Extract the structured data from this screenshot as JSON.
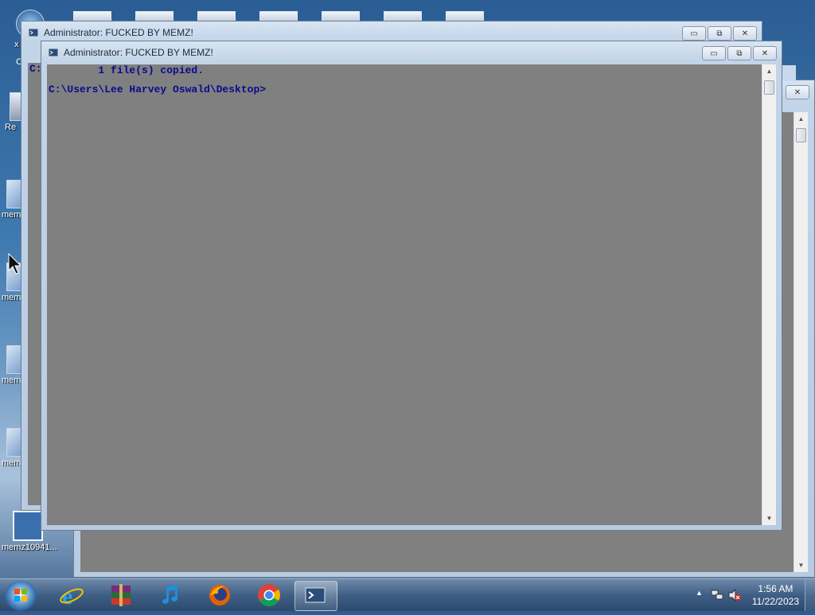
{
  "desktop": {
    "icon_labels": [
      "mem",
      "mem",
      "mem",
      "mem",
      "memz10941..."
    ],
    "partial_labels": [
      "x",
      "C",
      "Re"
    ]
  },
  "windows": {
    "back_title": "Administrator:  FUCKED BY MEMZ!",
    "back_partial_line": "C:",
    "front_title": "Administrator:  FUCKED BY MEMZ!",
    "console_lines": [
      "        1 file(s) copied.",
      "C:\\Users\\Lee Harvey Oswald\\Desktop>"
    ],
    "minimize_glyph": "▭",
    "restore_glyph": "⧉",
    "close_glyph": "✕",
    "scroll_up_glyph": "▲",
    "scroll_down_glyph": "▼"
  },
  "taskbar": {
    "pinned": [
      "internet-explorer-icon",
      "winrar-icon",
      "itunes-icon",
      "firefox-icon",
      "chrome-icon",
      "cmd-icon"
    ],
    "clock_time": "1:56 AM",
    "clock_date": "11/22/2023",
    "tray_arrow": "▲"
  },
  "colors": {
    "console_bg": "#808080",
    "console_text": "#0a0a8c",
    "taskbar": "#3f5f85"
  }
}
